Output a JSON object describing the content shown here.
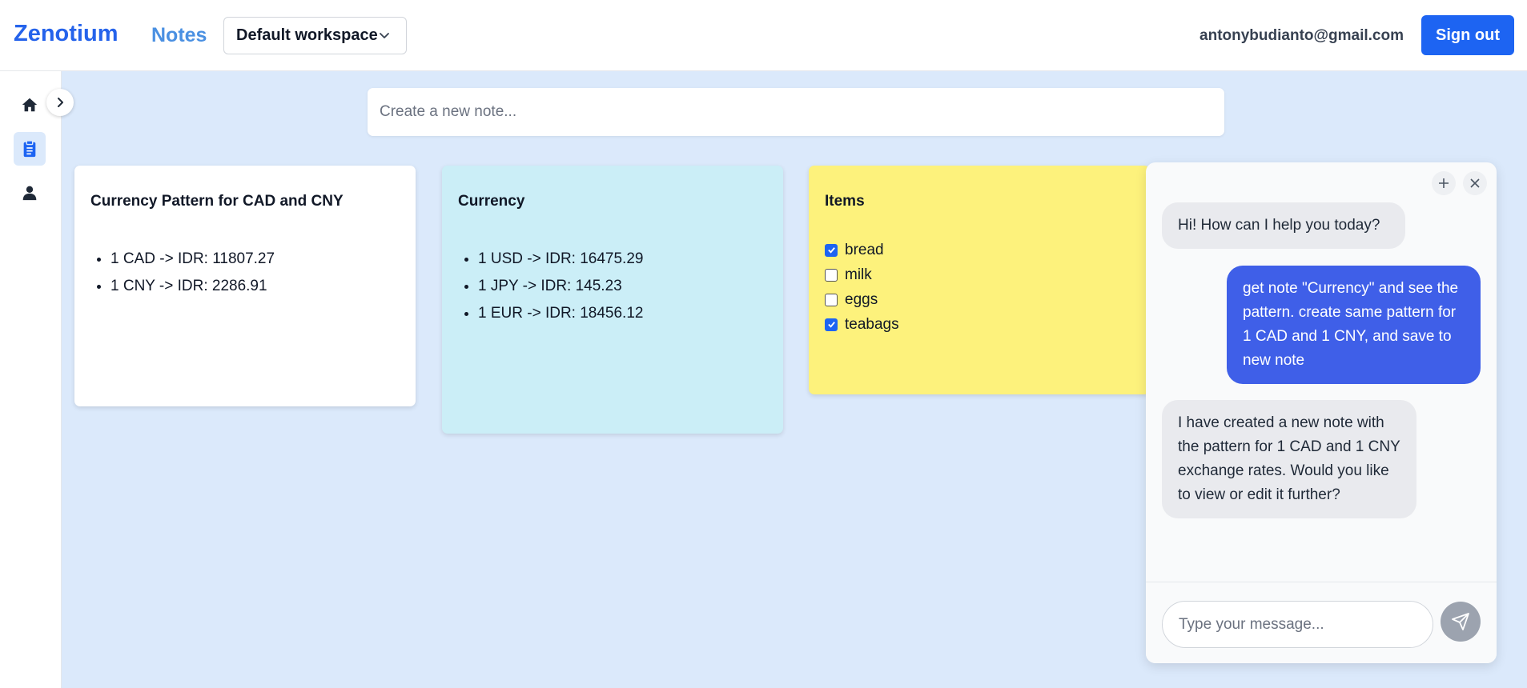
{
  "header": {
    "brand": "Zenotium",
    "nav_notes": "Notes",
    "workspace": "Default workspace",
    "email": "antonybudianto@gmail.com",
    "sign_out": "Sign out"
  },
  "sidebar": {
    "items": [
      {
        "name": "home",
        "icon": "home-icon"
      },
      {
        "name": "notes",
        "icon": "clipboard-icon",
        "active": true
      },
      {
        "name": "profile",
        "icon": "user-icon"
      }
    ]
  },
  "new_note": {
    "placeholder": "Create a new note..."
  },
  "notes": [
    {
      "title": "Currency Pattern for CAD and CNY",
      "color": "#ffffff",
      "items": [
        "1 CAD -> IDR: 11807.27",
        "1 CNY -> IDR: 2286.91"
      ]
    },
    {
      "title": "Currency",
      "color": "#cbeef7",
      "items": [
        "1 USD -> IDR: 16475.29",
        "1 JPY -> IDR: 145.23",
        "1 EUR -> IDR: 18456.12"
      ]
    },
    {
      "title": "Items",
      "color": "#fdf27c",
      "checklist": [
        {
          "label": "bread",
          "checked": true
        },
        {
          "label": "milk",
          "checked": false
        },
        {
          "label": "eggs",
          "checked": false
        },
        {
          "label": "teabags",
          "checked": true
        }
      ]
    }
  ],
  "chat": {
    "messages": [
      {
        "role": "assistant",
        "text": "Hi! How can I help you today?"
      },
      {
        "role": "user",
        "text": "get note \"Currency\" and see the pattern. create same pattern for 1 CAD and 1 CNY, and save to new note"
      },
      {
        "role": "assistant",
        "text": "I have created a new note with the pattern for 1 CAD and 1 CNY exchange rates. Would you like to view or edit it further?"
      }
    ],
    "input_placeholder": "Type your message..."
  },
  "colors": {
    "accent": "#1d64f2",
    "brand": "#2563eb",
    "background": "#dbe9fb",
    "user_bubble": "#3f5fe8"
  }
}
